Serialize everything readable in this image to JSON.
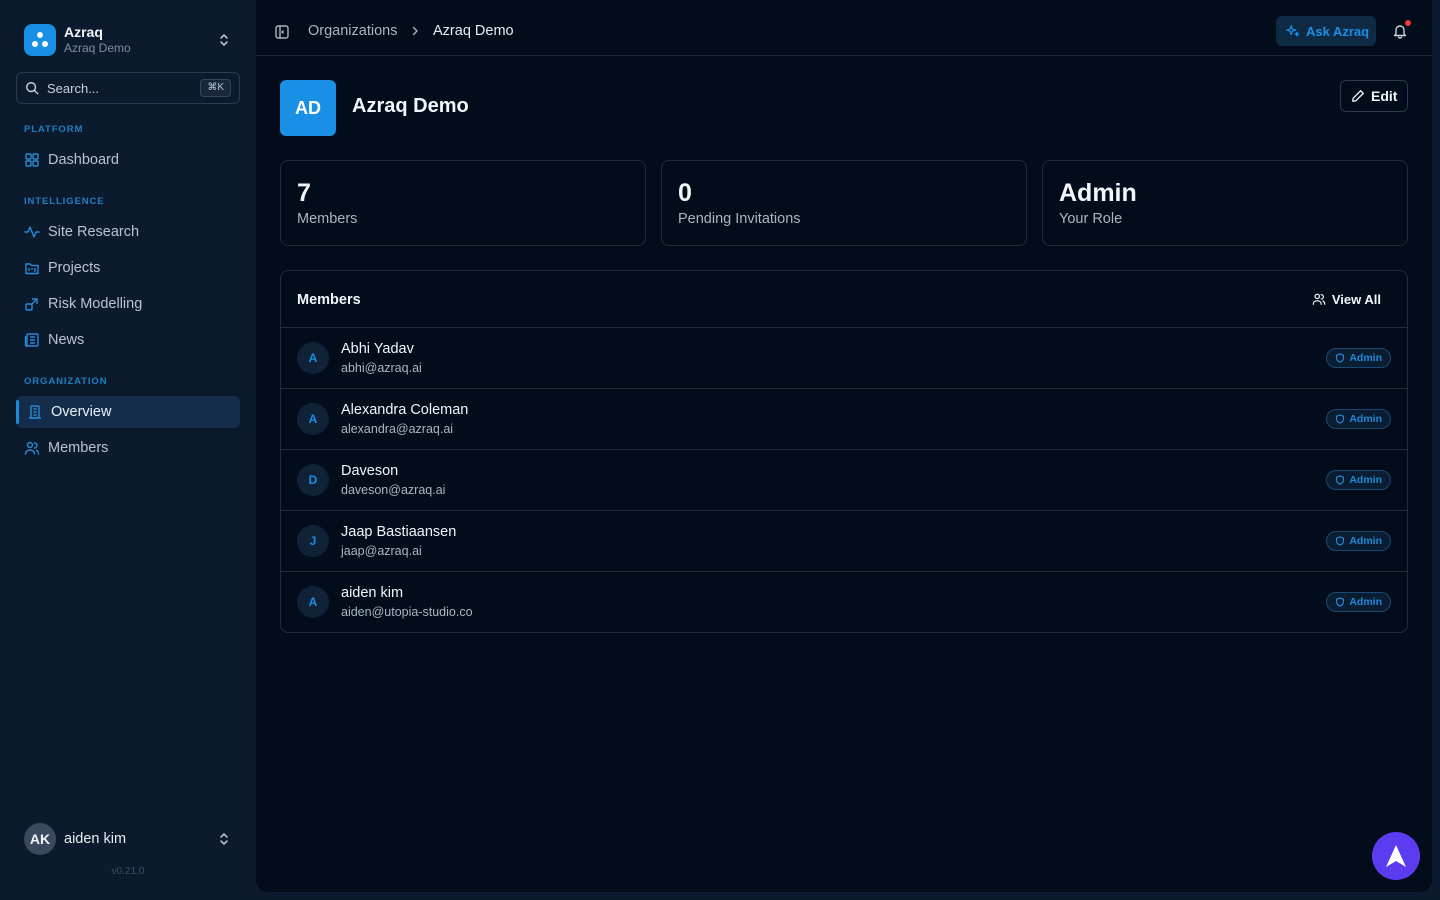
{
  "sidebar": {
    "org": {
      "name": "Azraq",
      "subtitle": "Azraq Demo"
    },
    "search": {
      "placeholder": "Search...",
      "shortcut": "⌘K"
    },
    "sections": {
      "platform": "PLATFORM",
      "intelligence": "INTELLIGENCE",
      "organization": "ORGANIZATION"
    },
    "items": {
      "dashboard": "Dashboard",
      "site_research": "Site Research",
      "projects": "Projects",
      "risk_modelling": "Risk Modelling",
      "news": "News",
      "overview": "Overview",
      "members": "Members"
    },
    "user": {
      "initials": "AK",
      "name": "aiden kim"
    },
    "version": "v0.21.0"
  },
  "topbar": {
    "breadcrumb": [
      "Organizations",
      "Azraq Demo"
    ],
    "ask_label": "Ask Azraq"
  },
  "org_header": {
    "initials": "AD",
    "name": "Azraq Demo",
    "edit_label": "Edit"
  },
  "stats": [
    {
      "value": "7",
      "label": "Members"
    },
    {
      "value": "0",
      "label": "Pending Invitations"
    },
    {
      "value": "Admin",
      "label": "Your Role"
    }
  ],
  "members_card": {
    "title": "Members",
    "view_all_label": "View All",
    "rows": [
      {
        "initial": "A",
        "name": "Abhi Yadav",
        "email": "abhi@azraq.ai",
        "role": "Admin"
      },
      {
        "initial": "A",
        "name": "Alexandra Coleman",
        "email": "alexandra@azraq.ai",
        "role": "Admin"
      },
      {
        "initial": "D",
        "name": "Daveson",
        "email": "daveson@azraq.ai",
        "role": "Admin"
      },
      {
        "initial": "J",
        "name": "Jaap Bastiaansen",
        "email": "jaap@azraq.ai",
        "role": "Admin"
      },
      {
        "initial": "A",
        "name": "aiden kim",
        "email": "aiden@utopia-studio.co",
        "role": "Admin"
      }
    ]
  },
  "colors": {
    "accent": "#1a8fe6",
    "sidebar_bg": "#0c1a2d",
    "main_bg": "#020c1a",
    "fab": "#5b3cf0",
    "notification_dot": "#ef3b3b"
  }
}
